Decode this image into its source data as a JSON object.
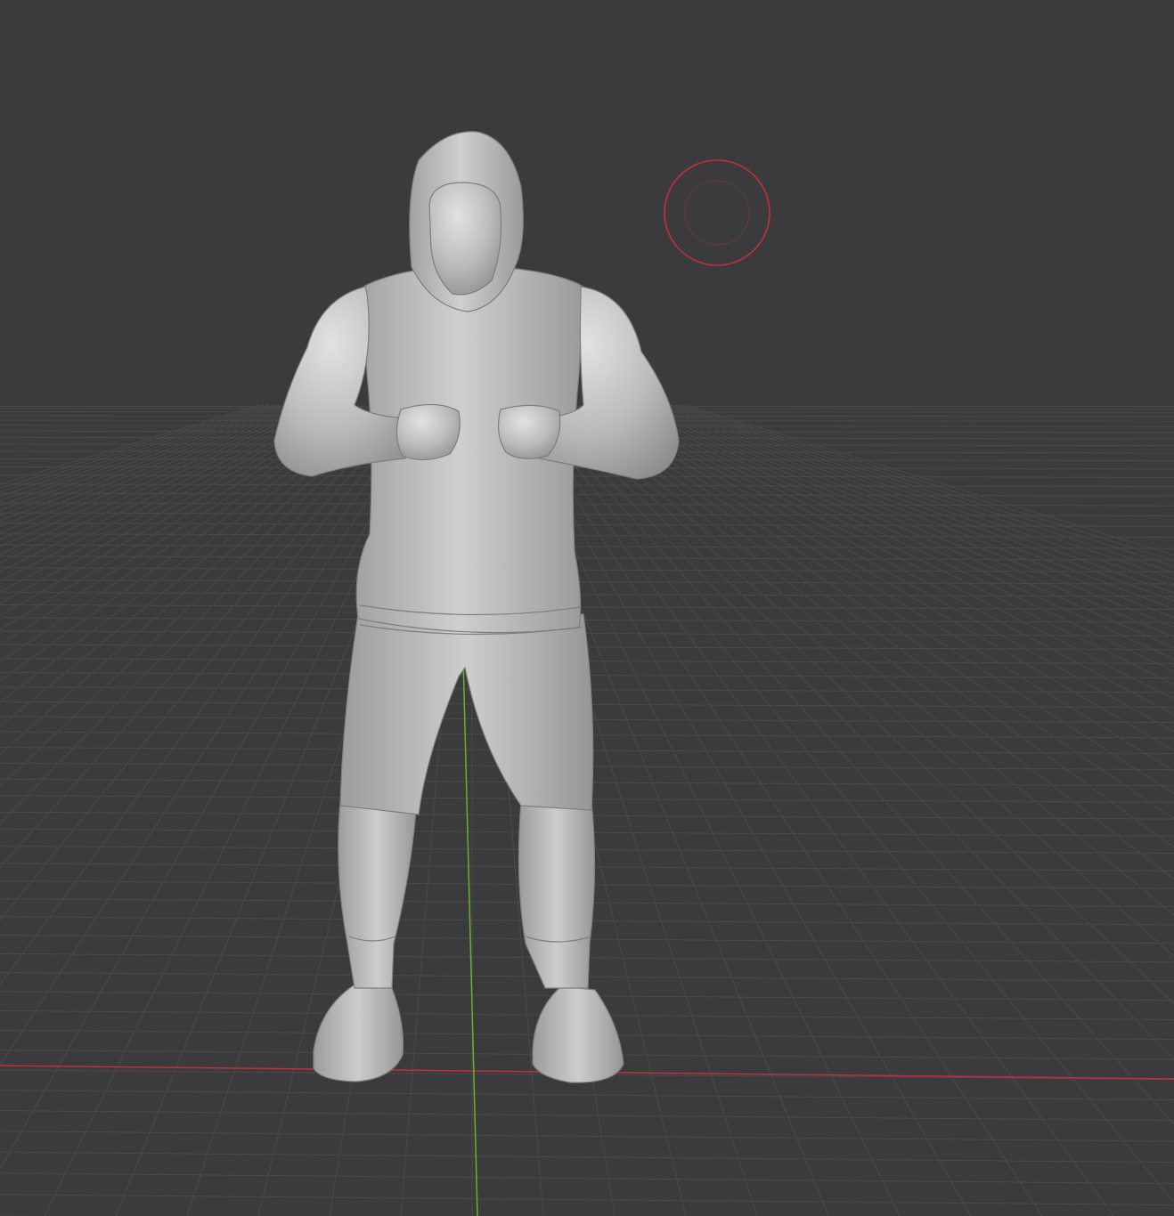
{
  "viewport": {
    "background_color": "#3b3b3d",
    "grid_color": "#4a4a4c",
    "x_axis_color": "#c0303a",
    "y_axis_color": "#6bb02a"
  },
  "scene": {
    "object": "hooded-muscular-man-sculpt",
    "object_color": "#b9b9b9",
    "brush_cursor_color": "#c0303a"
  }
}
